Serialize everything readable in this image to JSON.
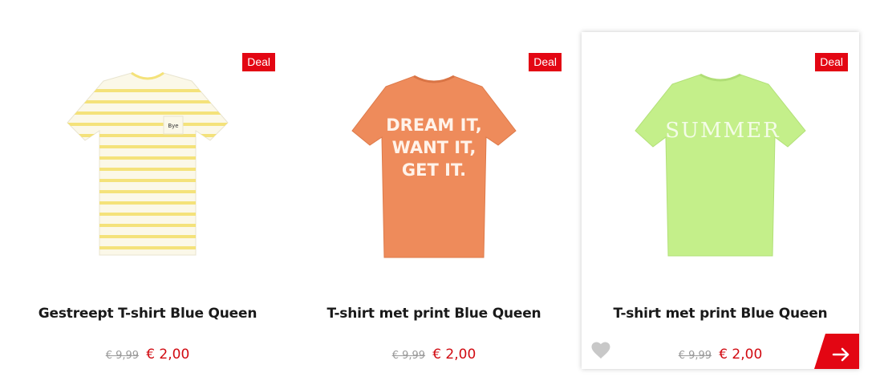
{
  "colors": {
    "deal_bg": "#e30613",
    "price_new": "#d10a11",
    "price_old": "#9a9a9a"
  },
  "products": [
    {
      "badge": "Deal",
      "title": "Gestreept T-shirt Blue Queen",
      "old_price": "€ 9,99",
      "new_price": "€ 2,00",
      "tee_color": "#fbf8e8",
      "stripe_color": "#f4e27a",
      "pocket_text": "Bye"
    },
    {
      "badge": "Deal",
      "title": "T-shirt met print Blue Queen",
      "old_price": "€ 9,99",
      "new_price": "€ 2,00",
      "tee_color": "#ee8b5b",
      "print_lines": [
        "DREAM IT,",
        "WANT IT,",
        "GET IT."
      ]
    },
    {
      "badge": "Deal",
      "title": "T-shirt met print Blue Queen",
      "old_price": "€ 9,99",
      "new_price": "€ 2,00",
      "tee_color": "#c4ef8a",
      "print_text": "SUMMER",
      "wishlist_icon": "heart-icon",
      "go_icon": "arrow-right-icon"
    }
  ]
}
